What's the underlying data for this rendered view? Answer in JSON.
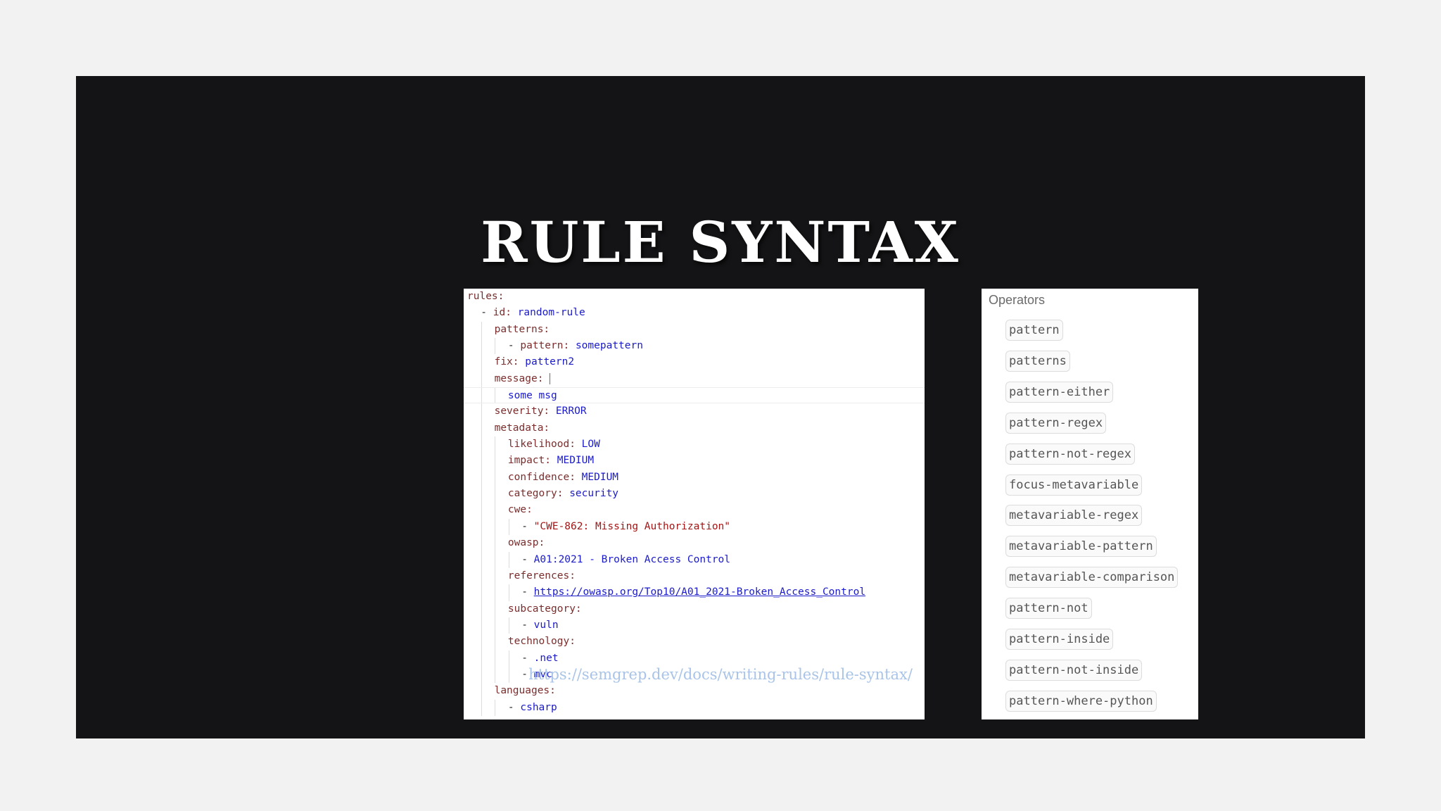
{
  "slide": {
    "title": "RULE SYNTAX",
    "source_url": "https://semgrep.dev/docs/writing-rules/rule-syntax/"
  },
  "code_lines": [
    {
      "indent": 0,
      "guides": [],
      "parts": [
        {
          "c": "k",
          "t": "rules:"
        }
      ]
    },
    {
      "indent": 1,
      "guides": [],
      "parts": [
        {
          "c": "d",
          "t": "- "
        },
        {
          "c": "k",
          "t": "id: "
        },
        {
          "c": "v",
          "t": "random-rule"
        }
      ]
    },
    {
      "indent": 2,
      "guides": [
        1
      ],
      "parts": [
        {
          "c": "k",
          "t": "patterns:"
        }
      ]
    },
    {
      "indent": 3,
      "guides": [
        1,
        2
      ],
      "parts": [
        {
          "c": "d",
          "t": "- "
        },
        {
          "c": "k",
          "t": "pattern: "
        },
        {
          "c": "v",
          "t": "somepattern"
        }
      ]
    },
    {
      "indent": 2,
      "guides": [
        1
      ],
      "parts": [
        {
          "c": "k",
          "t": "fix: "
        },
        {
          "c": "v",
          "t": "pattern2"
        }
      ]
    },
    {
      "indent": 2,
      "guides": [
        1
      ],
      "parts": [
        {
          "c": "k",
          "t": "message: "
        },
        {
          "c": "cursor",
          "t": ""
        }
      ]
    },
    {
      "indent": 3,
      "guides": [
        1,
        2
      ],
      "highlight": true,
      "parts": [
        {
          "c": "v",
          "t": "some msg"
        }
      ]
    },
    {
      "indent": 2,
      "guides": [
        1
      ],
      "parts": [
        {
          "c": "k",
          "t": "severity: "
        },
        {
          "c": "v",
          "t": "ERROR"
        }
      ]
    },
    {
      "indent": 2,
      "guides": [
        1
      ],
      "parts": [
        {
          "c": "k",
          "t": "metadata:"
        }
      ]
    },
    {
      "indent": 3,
      "guides": [
        1,
        2
      ],
      "parts": [
        {
          "c": "k",
          "t": "likelihood: "
        },
        {
          "c": "v",
          "t": "LOW"
        }
      ]
    },
    {
      "indent": 3,
      "guides": [
        1,
        2
      ],
      "parts": [
        {
          "c": "k",
          "t": "impact: "
        },
        {
          "c": "v",
          "t": "MEDIUM"
        }
      ]
    },
    {
      "indent": 3,
      "guides": [
        1,
        2
      ],
      "parts": [
        {
          "c": "k",
          "t": "confidence: "
        },
        {
          "c": "v",
          "t": "MEDIUM"
        }
      ]
    },
    {
      "indent": 3,
      "guides": [
        1,
        2
      ],
      "parts": [
        {
          "c": "k",
          "t": "category: "
        },
        {
          "c": "v",
          "t": "security"
        }
      ]
    },
    {
      "indent": 3,
      "guides": [
        1,
        2
      ],
      "parts": [
        {
          "c": "k",
          "t": "cwe:"
        }
      ]
    },
    {
      "indent": 4,
      "guides": [
        1,
        2,
        3
      ],
      "parts": [
        {
          "c": "d",
          "t": "- "
        },
        {
          "c": "s",
          "t": "\"CWE-862: Missing Authorization\""
        }
      ]
    },
    {
      "indent": 3,
      "guides": [
        1,
        2
      ],
      "parts": [
        {
          "c": "k",
          "t": "owasp:"
        }
      ]
    },
    {
      "indent": 4,
      "guides": [
        1,
        2,
        3
      ],
      "parts": [
        {
          "c": "d",
          "t": "- "
        },
        {
          "c": "v",
          "t": "A01:2021 - Broken Access Control"
        }
      ]
    },
    {
      "indent": 3,
      "guides": [
        1,
        2
      ],
      "parts": [
        {
          "c": "k",
          "t": "references:"
        }
      ]
    },
    {
      "indent": 4,
      "guides": [
        1,
        2,
        3
      ],
      "parts": [
        {
          "c": "d",
          "t": "- "
        },
        {
          "c": "link",
          "t": "https://owasp.org/Top10/A01_2021-Broken_Access_Control"
        }
      ]
    },
    {
      "indent": 3,
      "guides": [
        1,
        2
      ],
      "parts": [
        {
          "c": "k",
          "t": "subcategory:"
        }
      ]
    },
    {
      "indent": 4,
      "guides": [
        1,
        2,
        3
      ],
      "parts": [
        {
          "c": "d",
          "t": "- "
        },
        {
          "c": "v",
          "t": "vuln"
        }
      ]
    },
    {
      "indent": 3,
      "guides": [
        1,
        2
      ],
      "parts": [
        {
          "c": "k",
          "t": "technology:"
        }
      ]
    },
    {
      "indent": 4,
      "guides": [
        1,
        2,
        3
      ],
      "parts": [
        {
          "c": "d",
          "t": "- "
        },
        {
          "c": "v",
          "t": ".net"
        }
      ]
    },
    {
      "indent": 4,
      "guides": [
        1,
        2,
        3
      ],
      "parts": [
        {
          "c": "d",
          "t": "- "
        },
        {
          "c": "v",
          "t": "mvc"
        }
      ]
    },
    {
      "indent": 2,
      "guides": [
        1
      ],
      "parts": [
        {
          "c": "k",
          "t": "languages:"
        }
      ]
    },
    {
      "indent": 3,
      "guides": [
        1,
        2
      ],
      "parts": [
        {
          "c": "d",
          "t": "- "
        },
        {
          "c": "v",
          "t": "csharp"
        }
      ]
    }
  ],
  "operators": {
    "title": "Operators",
    "items": [
      "pattern",
      "patterns",
      "pattern-either",
      "pattern-regex",
      "pattern-not-regex",
      "focus-metavariable",
      "metavariable-regex",
      "metavariable-pattern",
      "metavariable-comparison",
      "pattern-not",
      "pattern-inside",
      "pattern-not-inside",
      "pattern-where-python"
    ]
  },
  "colors": {
    "background": "#f2f2f3",
    "slide": "#141416",
    "code_key": "#7a2d2d",
    "code_value": "#1a1acb",
    "code_string": "#a31515",
    "link": "#a9c4e8"
  }
}
